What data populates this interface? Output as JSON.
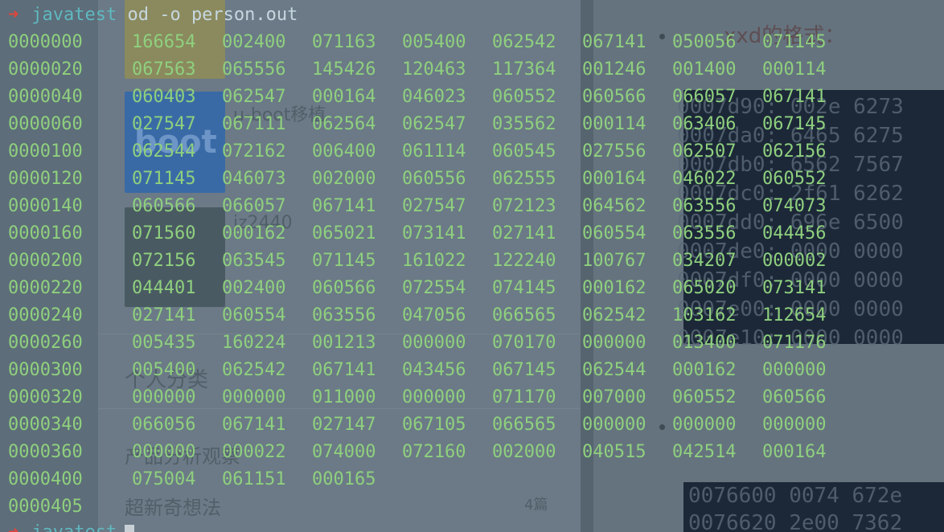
{
  "prompt": {
    "arrow": "➜",
    "directory": "javatest",
    "command": "od -o person.out"
  },
  "dump_rows": [
    {
      "offset": "0000000",
      "words": [
        "166654",
        "002400",
        "071163",
        "005400",
        "062542",
        "067141",
        "050056",
        "071145"
      ]
    },
    {
      "offset": "0000020",
      "words": [
        "067563",
        "065556",
        "145426",
        "120463",
        "117364",
        "001246",
        "001400",
        "000114"
      ]
    },
    {
      "offset": "0000040",
      "words": [
        "060403",
        "062547",
        "000164",
        "046023",
        "060552",
        "060566",
        "066057",
        "067141"
      ]
    },
    {
      "offset": "0000060",
      "words": [
        "027547",
        "067111",
        "062564",
        "062547",
        "035562",
        "000114",
        "063406",
        "067145"
      ]
    },
    {
      "offset": "0000100",
      "words": [
        "062544",
        "072162",
        "006400",
        "061114",
        "060545",
        "027556",
        "062507",
        "062156"
      ]
    },
    {
      "offset": "0000120",
      "words": [
        "071145",
        "046073",
        "002000",
        "060556",
        "062555",
        "000164",
        "046022",
        "060552"
      ]
    },
    {
      "offset": "0000140",
      "words": [
        "060566",
        "066057",
        "067141",
        "027547",
        "072123",
        "064562",
        "063556",
        "074073"
      ]
    },
    {
      "offset": "0000160",
      "words": [
        "071560",
        "000162",
        "065021",
        "073141",
        "027141",
        "060554",
        "063556",
        "044456"
      ]
    },
    {
      "offset": "0000200",
      "words": [
        "072156",
        "063545",
        "071145",
        "161022",
        "122240",
        "100767",
        "034207",
        "000002"
      ]
    },
    {
      "offset": "0000220",
      "words": [
        "044401",
        "002400",
        "060566",
        "072554",
        "074145",
        "000162",
        "065020",
        "073141"
      ]
    },
    {
      "offset": "0000240",
      "words": [
        "027141",
        "060554",
        "063556",
        "047056",
        "066565",
        "062542",
        "103162",
        "112654"
      ]
    },
    {
      "offset": "0000260",
      "words": [
        "005435",
        "160224",
        "001213",
        "000000",
        "070170",
        "000000",
        "013400",
        "071176"
      ]
    },
    {
      "offset": "0000300",
      "words": [
        "005400",
        "062542",
        "067141",
        "043456",
        "067145",
        "062544",
        "000162",
        "000000"
      ]
    },
    {
      "offset": "0000320",
      "words": [
        "000000",
        "000000",
        "011000",
        "000000",
        "071170",
        "007000",
        "060552",
        "060566"
      ]
    },
    {
      "offset": "0000340",
      "words": [
        "066056",
        "067141",
        "027147",
        "067105",
        "066565",
        "000000",
        "000000",
        "000000"
      ]
    },
    {
      "offset": "0000360",
      "words": [
        "000000",
        "000022",
        "074000",
        "072160",
        "002000",
        "040515",
        "042514",
        "000164"
      ]
    },
    {
      "offset": "0000400",
      "words": [
        "075004",
        "061151",
        "000165"
      ]
    },
    {
      "offset": "0000405",
      "words": []
    }
  ],
  "next_prompt": {
    "arrow": "➜",
    "directory": "javatest"
  },
  "background": {
    "xxd_heading": "xxd的格式：",
    "thumb_label": "boot",
    "uboot_title": "u-boot移植",
    "jz_title": "jz2440",
    "personal_heading": "个人分类",
    "category_1": "产品分析观察",
    "category_2": "超新奇想法",
    "category_2_count": "4篇",
    "hex_lines": [
      "0007d90: 002e 6273",
      "0007da0: 6465 6275",
      "0007db0: 6562 7567",
      "0007dc0: 2f61 6262",
      "0007dd0: 696e 6500",
      "0007de0: 0000 0000",
      "0007df0: 0000 0000",
      "0007e00: 0000 0000",
      "0007e10: 0000 0000"
    ],
    "hex_lines_bottom": [
      "0076600 0074 672e",
      "0076620 2e00 7362"
    ]
  }
}
